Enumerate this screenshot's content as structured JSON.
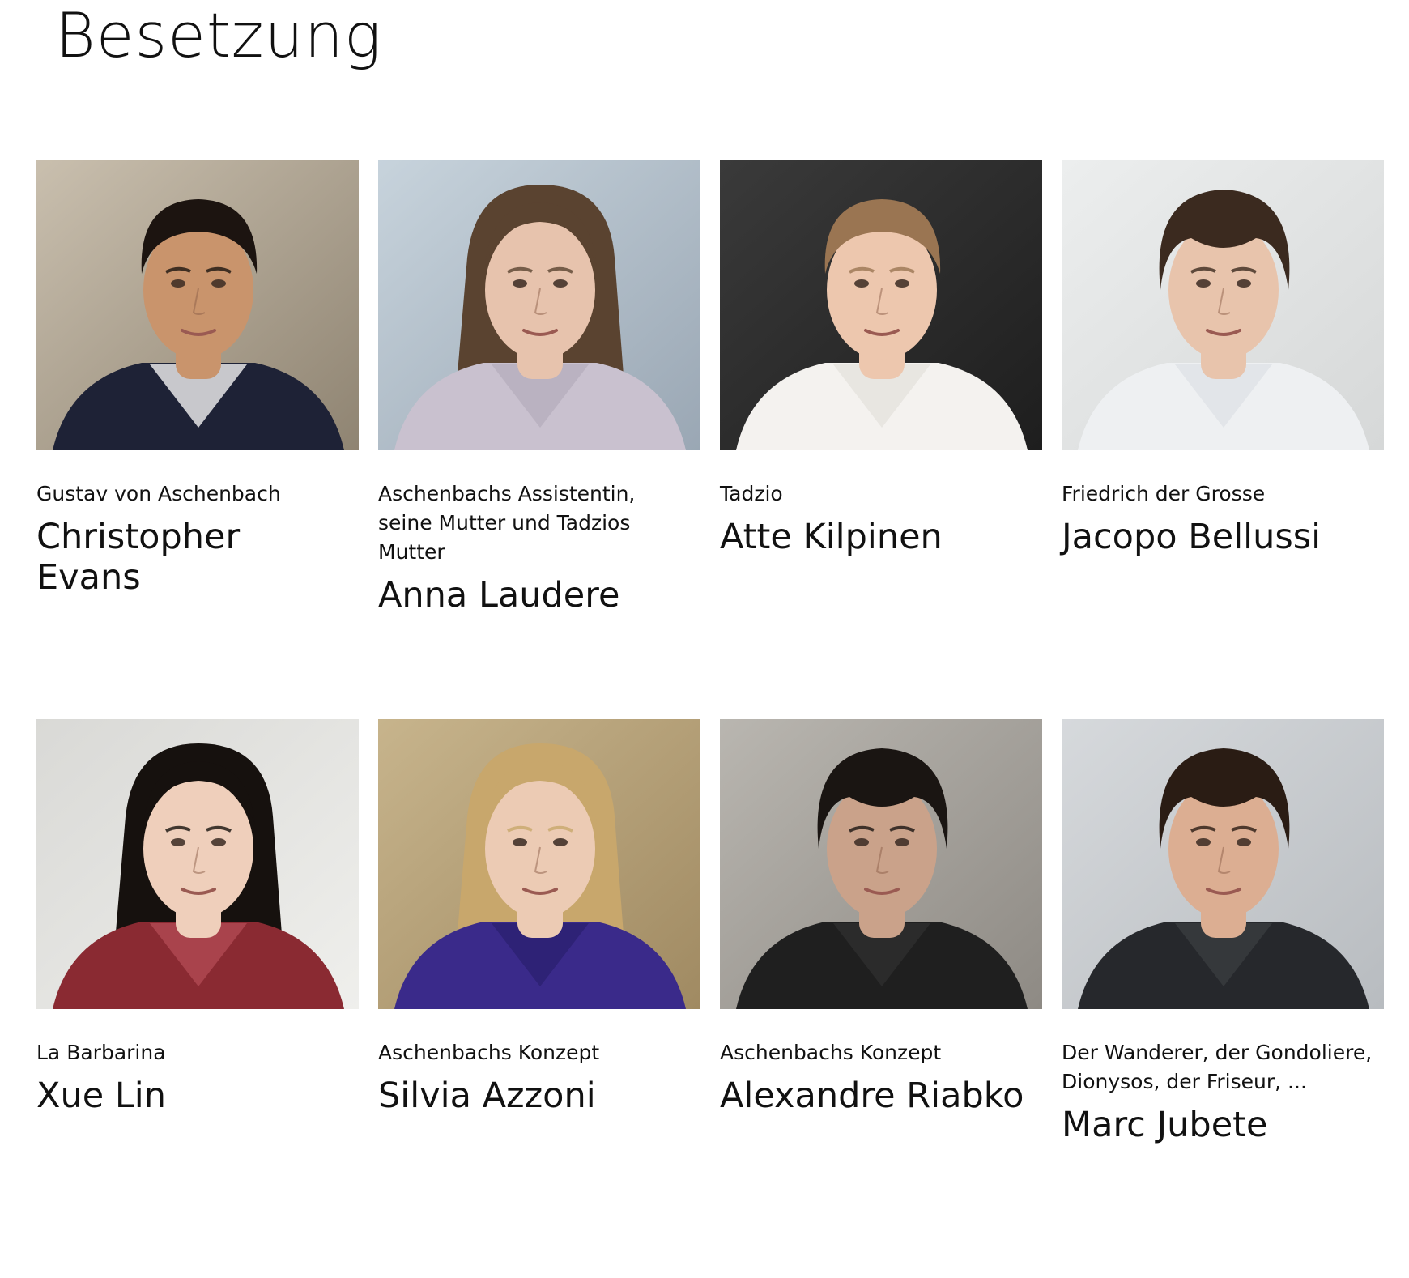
{
  "page": {
    "title": "Besetzung"
  },
  "cast": [
    {
      "role": "Gustav von Aschenbach",
      "name": "Christopher Evans",
      "photo": {
        "bg": "#c9bfae",
        "bg2": "#8f8472",
        "skin": "#c9946c",
        "hair": "#1c1410",
        "hair_style": "short",
        "shirt": "#1e2236",
        "shirt2": "#f2f2f2"
      }
    },
    {
      "role": "Aschenbachs Assistentin, seine Mutter und Tadzios Mutter",
      "name": "Anna Laudere",
      "photo": {
        "bg": "#c7d3dc",
        "bg2": "#9aa7b4",
        "skin": "#e7c3ad",
        "hair": "#5a4330",
        "hair_style": "long",
        "shirt": "#c9c1cf",
        "shirt2": "#b7aebd"
      }
    },
    {
      "role": "Tadzio",
      "name": "Atte Kilpinen",
      "photo": {
        "bg": "#3a3a3a",
        "bg2": "#1e1e1e",
        "skin": "#edc7ae",
        "hair": "#9a7552",
        "hair_style": "short",
        "shirt": "#f4f2ef",
        "shirt2": "#e5e2dd"
      }
    },
    {
      "role": "Friedrich der Grosse",
      "name": "Jacopo Bellussi",
      "photo": {
        "bg": "#eceeee",
        "bg2": "#d6d8d8",
        "skin": "#e8c4ac",
        "hair": "#3b2a1f",
        "hair_style": "shaggy",
        "shirt": "#eef0f2",
        "shirt2": "#dfe2e6"
      }
    },
    {
      "role": "La Barbarina",
      "name": "Xue Lin",
      "photo": {
        "bg": "#d9d9d6",
        "bg2": "#efefec",
        "skin": "#efcfbb",
        "hair": "#16110e",
        "hair_style": "long",
        "shirt": "#8a2a32",
        "shirt2": "#b04a52"
      }
    },
    {
      "role": "Aschenbachs Konzept",
      "name": "Silvia Azzoni",
      "photo": {
        "bg": "#c7b48c",
        "bg2": "#a08a62",
        "skin": "#eccbb4",
        "hair": "#c8a76c",
        "hair_style": "long",
        "shirt": "#3a2a8a",
        "shirt2": "#2c2070"
      }
    },
    {
      "role": "Aschenbachs Konzept",
      "name": "Alexandre Riabko",
      "photo": {
        "bg": "#b9b6b0",
        "bg2": "#8e8a84",
        "skin": "#caa28a",
        "hair": "#1a1512",
        "hair_style": "shaggy",
        "shirt": "#1f1f1f",
        "shirt2": "#2e2e2e"
      }
    },
    {
      "role": "Der Wanderer, der Gondoliere, Dionysos, der Friseur, ...",
      "name": "Marc Jubete",
      "photo": {
        "bg": "#d6d9dc",
        "bg2": "#b8bcc0",
        "skin": "#dcae92",
        "hair": "#2a1c14",
        "hair_style": "shaggy",
        "shirt": "#26282c",
        "shirt2": "#3a3c40"
      }
    }
  ]
}
